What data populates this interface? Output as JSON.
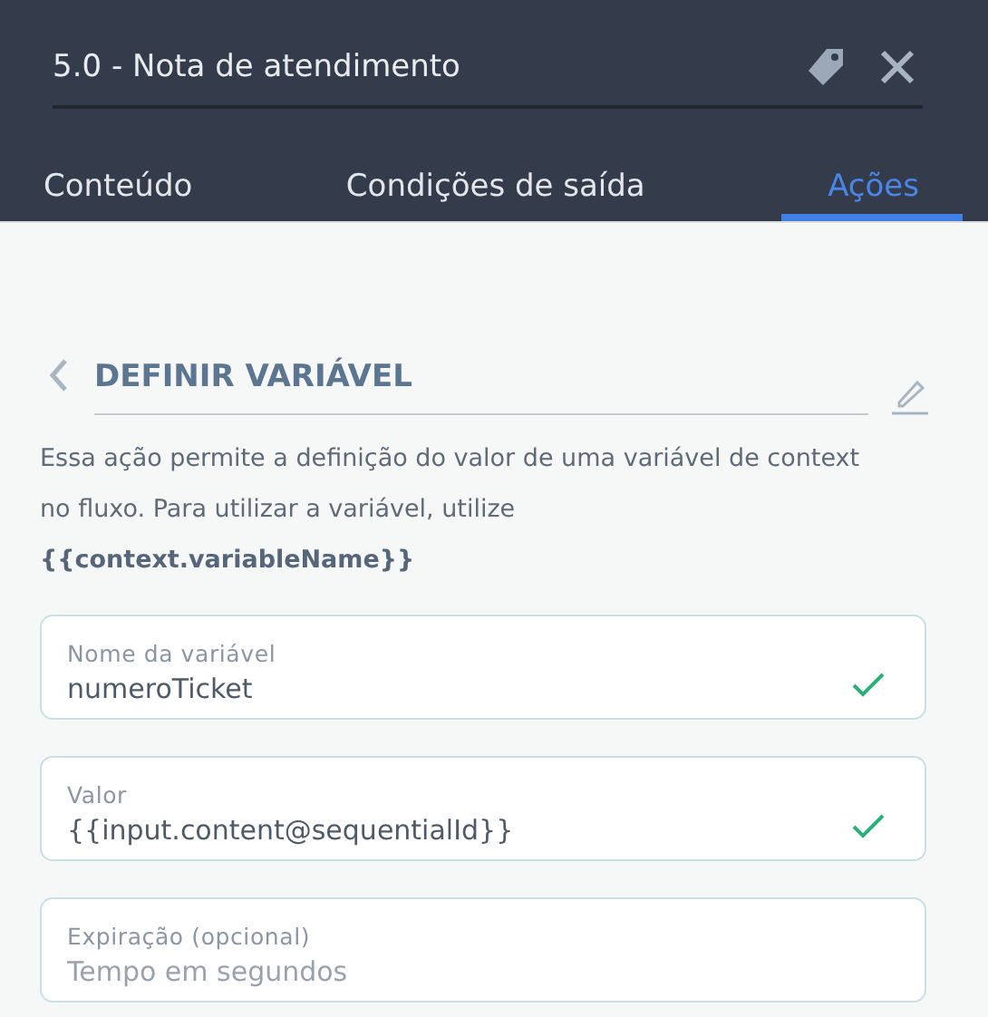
{
  "header": {
    "title": "5.0 - Nota de atendimento"
  },
  "tabs": [
    {
      "label": "Conteúdo",
      "selected": false
    },
    {
      "label": "Condições de saída",
      "selected": false
    },
    {
      "label": "Ações",
      "selected": true
    }
  ],
  "action": {
    "title": "DEFINIR VARIÁVEL",
    "description": "Essa ação permite a definição do valor de uma variável de context no fluxo. Para utilizar a variável, utilize **{{context.variableName}}**"
  },
  "fields": [
    {
      "label": "Nome da variável",
      "value": "numeroTicket",
      "valid": true
    },
    {
      "label": "Valor",
      "value": "{{input.content@sequentialId}}",
      "valid": true
    },
    {
      "label": "Expiração (opcional)",
      "placeholder": "Tempo em segundos",
      "valid": false
    }
  ]
}
